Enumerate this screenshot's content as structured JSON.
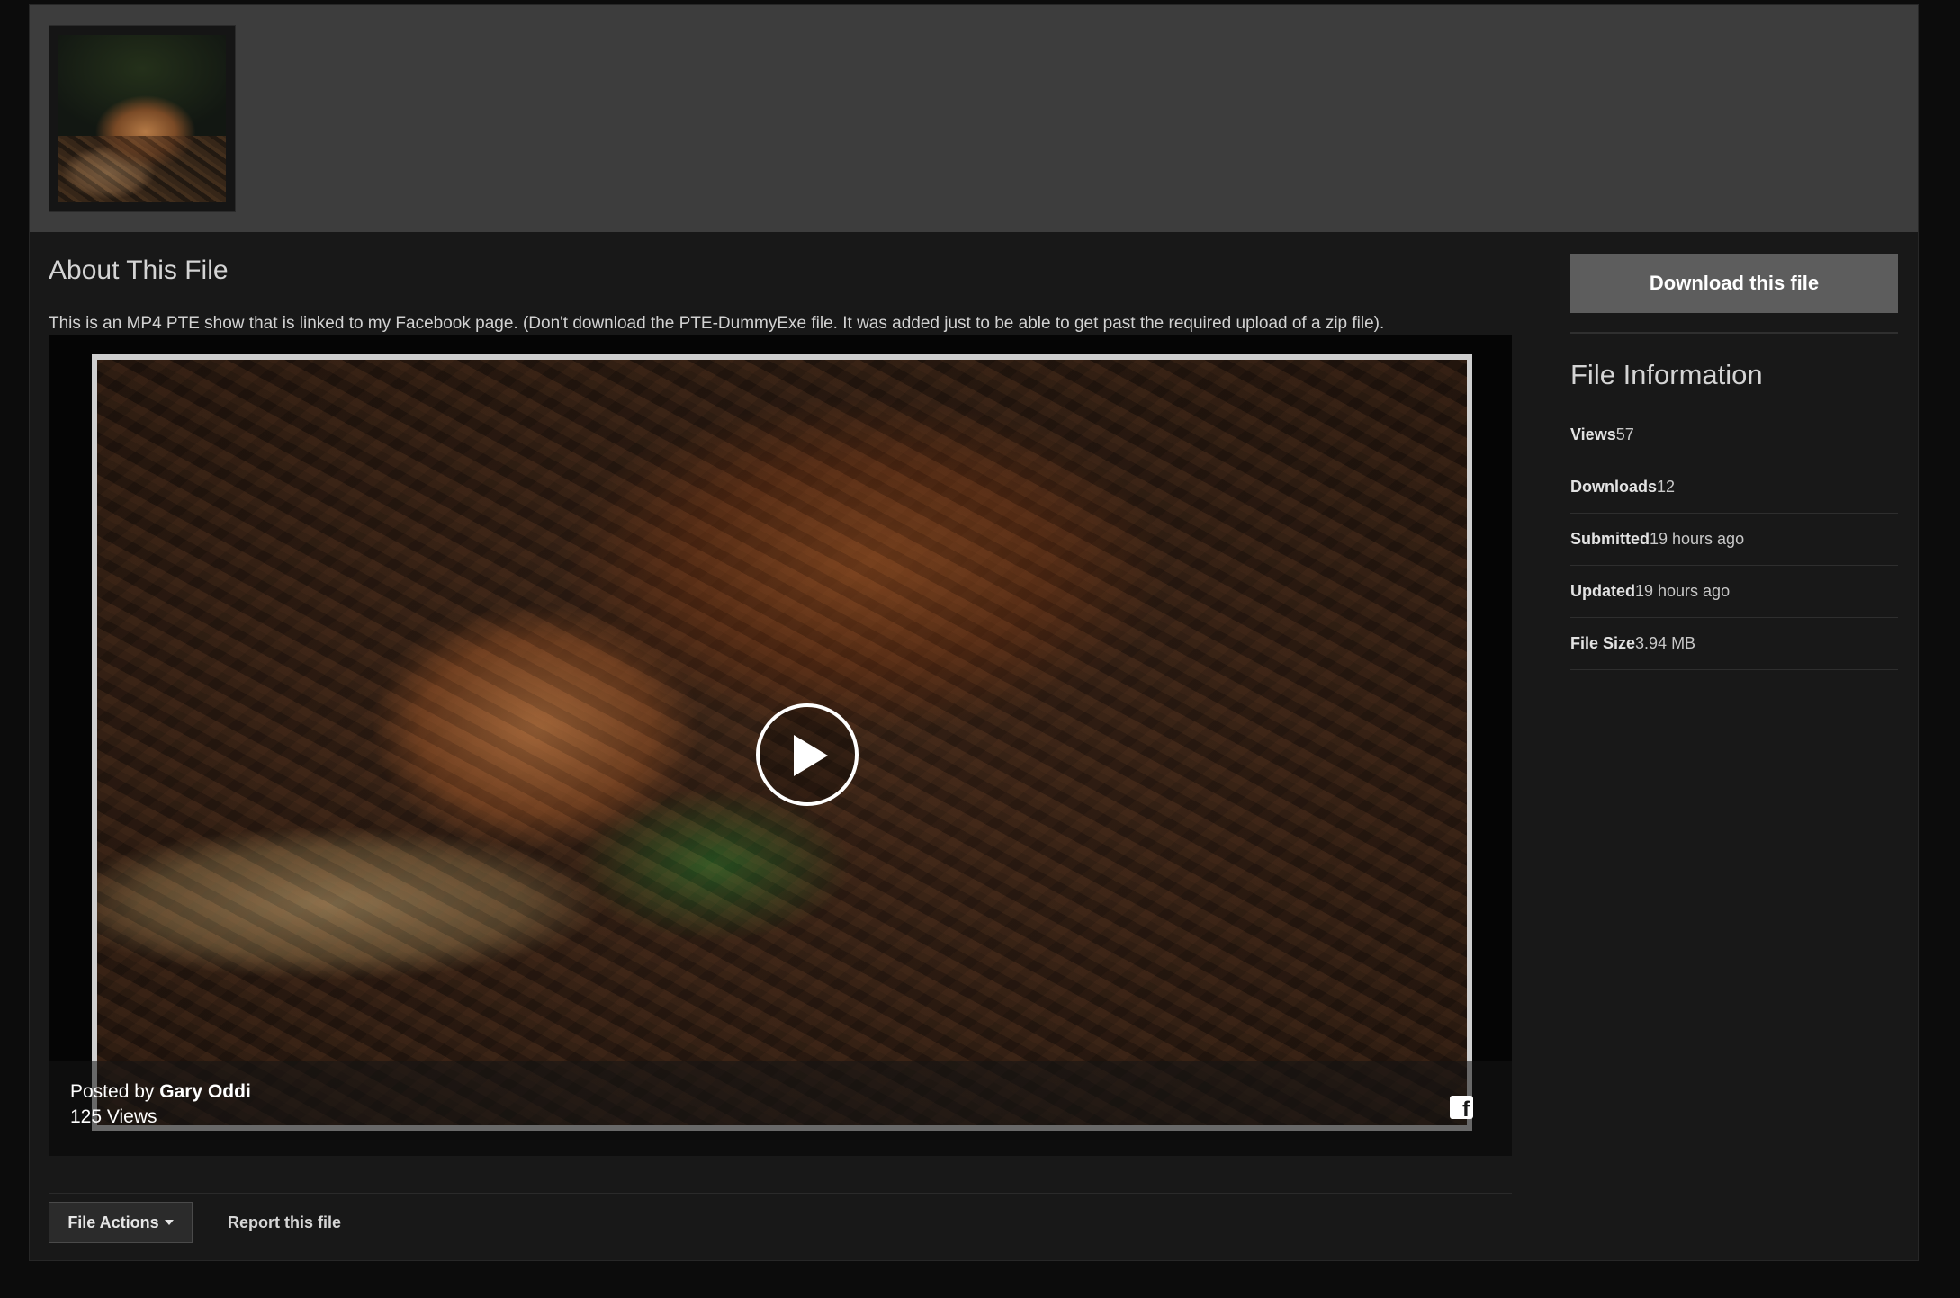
{
  "about": {
    "title": "About This File",
    "description": "This is an MP4 PTE show that is linked to my Facebook page. (Don't download the PTE-DummyExe file. It was added just to be able to get past the required upload of a zip file)."
  },
  "video": {
    "posted_prefix": "Posted by",
    "author": "Gary Oddi",
    "views": "125 Views"
  },
  "actions": {
    "file_actions_label": "File Actions",
    "report_label": "Report this file"
  },
  "sidebar": {
    "download_label": "Download this file",
    "info_title": "File Information",
    "rows": [
      {
        "key": "Views",
        "value": "57"
      },
      {
        "key": "Downloads",
        "value": "12"
      },
      {
        "key": "Submitted",
        "value": "19 hours ago"
      },
      {
        "key": "Updated",
        "value": "19 hours ago"
      },
      {
        "key": "File Size",
        "value": "3.94 MB"
      }
    ]
  },
  "colors": {
    "background": "#0c0c0c",
    "card": "#181818",
    "header_band": "#3d3d3d",
    "download_button": "#5d5d5d"
  }
}
